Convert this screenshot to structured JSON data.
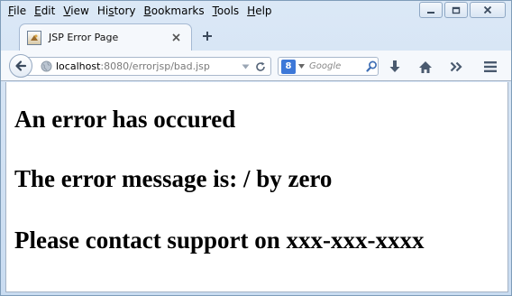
{
  "menu": [
    {
      "accel": "F",
      "rest": "ile"
    },
    {
      "accel": "E",
      "rest": "dit"
    },
    {
      "accel": "V",
      "rest": "iew"
    },
    {
      "accel": "",
      "prefix": "Hi",
      "mid": "s",
      "rest": "tory"
    },
    {
      "accel": "B",
      "rest": "ookmarks"
    },
    {
      "accel": "T",
      "rest": "ools"
    },
    {
      "accel": "H",
      "rest": "elp"
    }
  ],
  "menu_labels": [
    "File",
    "Edit",
    "View",
    "History",
    "Bookmarks",
    "Tools",
    "Help"
  ],
  "tab": {
    "title": "JSP Error Page"
  },
  "address": {
    "host": "localhost",
    "path": ":8080/errorjsp/bad.jsp"
  },
  "search": {
    "placeholder": "Google",
    "engine_letter": "8"
  },
  "icons": {
    "back": "back-arrow-icon",
    "globe": "globe-icon",
    "dropdown": "dropdown-icon",
    "reload": "reload-icon",
    "search": "search-icon",
    "download": "download-icon",
    "home": "home-icon",
    "overflow": "overflow-icon",
    "menu": "hamburger-menu-icon"
  },
  "page": {
    "line1": "An error has occured",
    "line2": "The error message is: / by zero",
    "line3": "Please contact support on xxx-xxx-xxxx"
  },
  "colors": {
    "accent": "#3d78d8",
    "chrome": "#cfe0f3"
  }
}
